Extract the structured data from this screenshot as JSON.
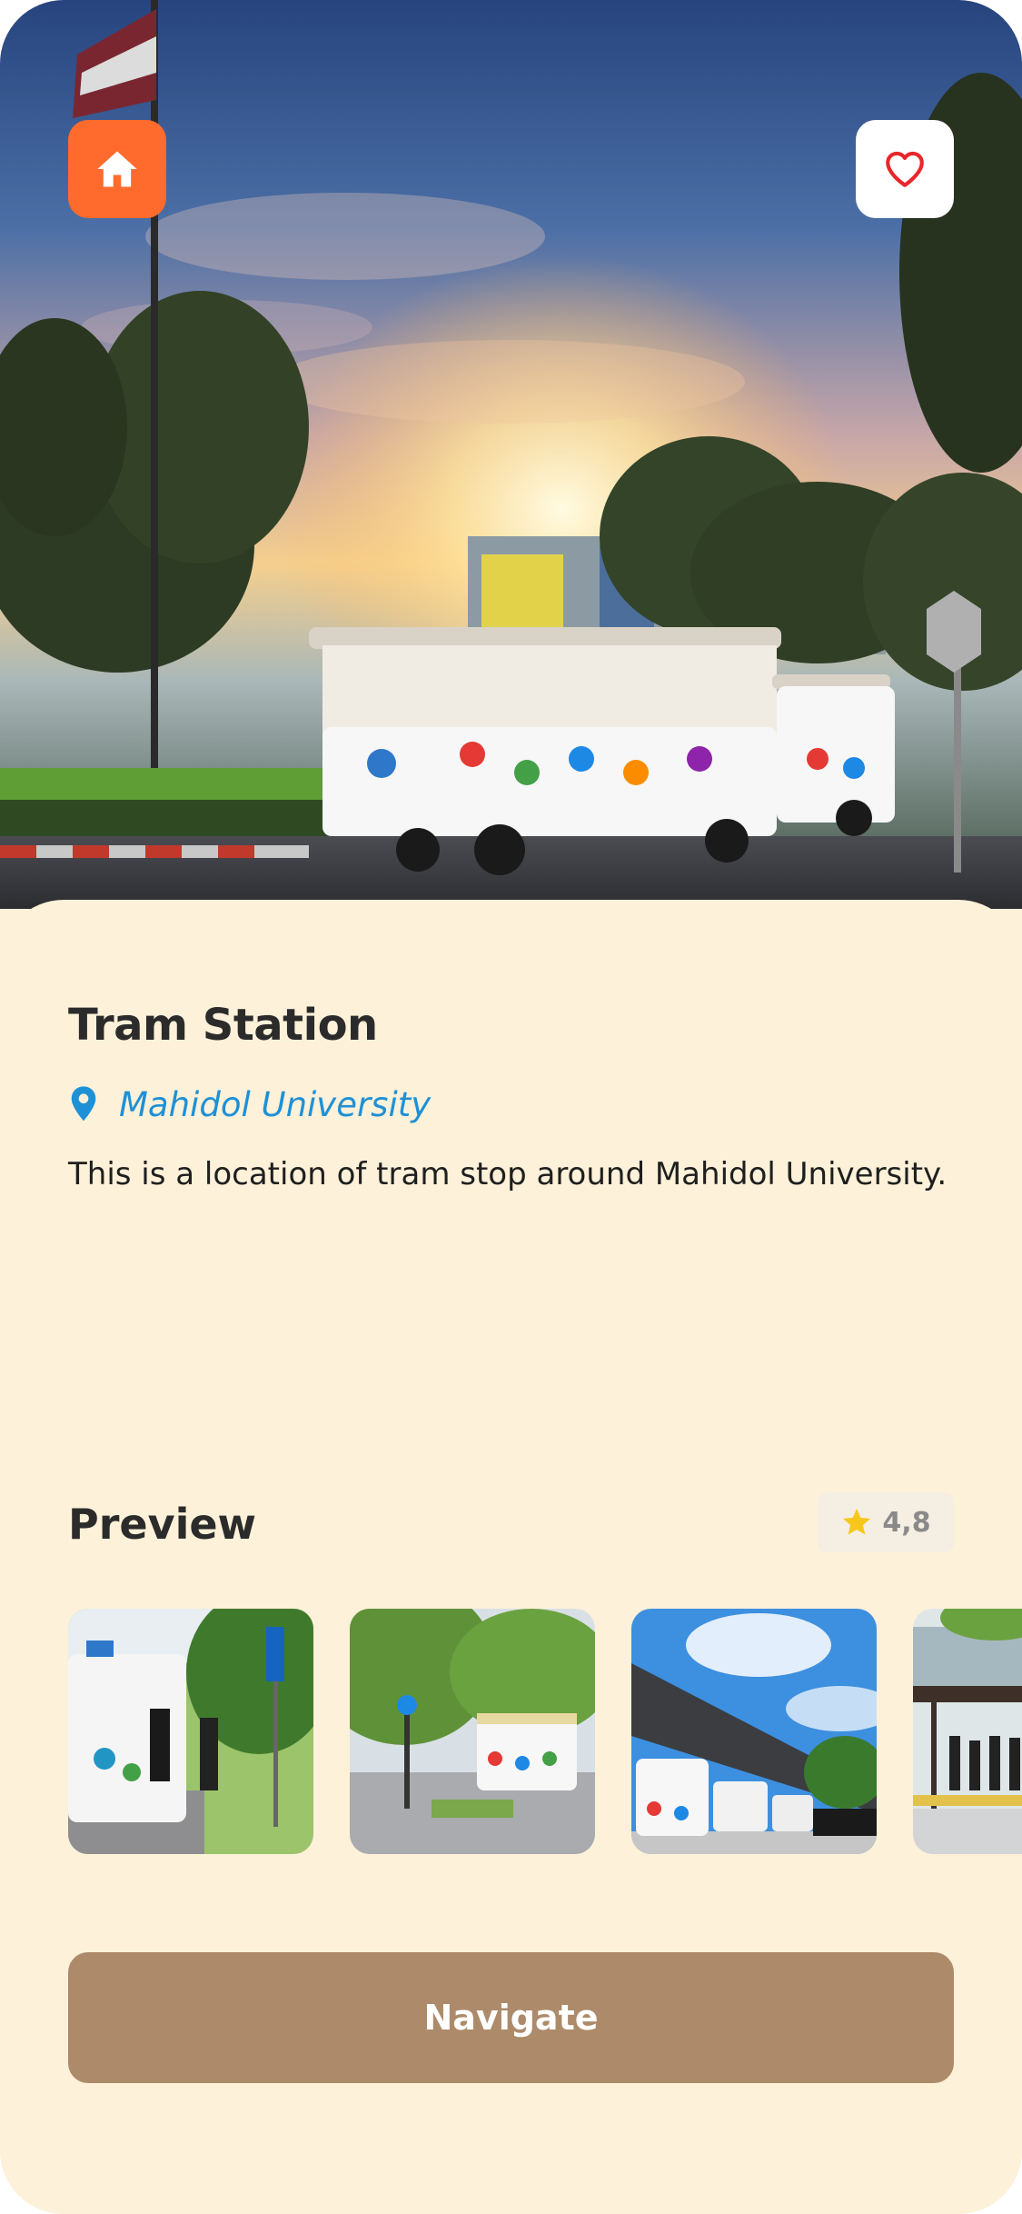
{
  "header": {
    "home_icon": "home-icon",
    "favorite_icon": "heart-outline-icon"
  },
  "place": {
    "title": "Tram Station",
    "location": "Mahidol University",
    "description": "This is a location of tram stop around Mahidol University."
  },
  "preview": {
    "title": "Preview",
    "rating": "4,8",
    "rating_icon": "star-icon"
  },
  "actions": {
    "navigate_label": "Navigate"
  },
  "colors": {
    "accent": "#ff6b2c",
    "background": "#fdf1d9",
    "link": "#1e90d6",
    "button": "#ad8b6a",
    "heart": "#e8262b",
    "star": "#f7c71b"
  }
}
